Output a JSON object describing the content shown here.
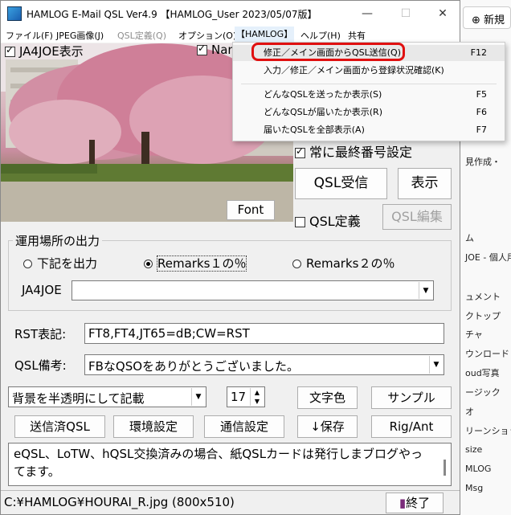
{
  "background_window": {
    "new_button": "新規",
    "items": [
      "ム",
      "JOE - 個人用",
      "ュメント",
      "クトップ",
      "チャ",
      "ウンロード",
      "oud写真",
      "ージック",
      "オ",
      "リーンショット",
      "size",
      "MLOG",
      "Msg",
      "見作成・"
    ]
  },
  "window": {
    "title": "HAMLOG E-Mail QSL Ver4.9 【HAMLOG_User 2023/05/07版】",
    "minimize": "—",
    "maximize": "☐",
    "close": "✕"
  },
  "menu": [
    "ファイル(F)",
    "JPEG画像(J)",
    "QSL定義(Q)",
    "オプション(O)",
    "【HAMLOG】",
    "ヘルプ(H)",
    "共有"
  ],
  "dropdown": [
    {
      "label": "修正／メイン画面からQSL送信(Q)",
      "key": "F12"
    },
    {
      "label": "入力／修正／メイン画面から登録状況確認(K)",
      "key": ""
    },
    {
      "label": "どんなQSLを送ったか表示(S)",
      "key": "F5"
    },
    {
      "label": "どんなQSLが届いたか表示(R)",
      "key": "F6"
    },
    {
      "label": "届いたQSLを全部表示(A)",
      "key": "F7"
    }
  ],
  "image_options": {
    "show_call": "JA4JOE表示",
    "show_name": "Nam",
    "font_button": "Font"
  },
  "right_controls": {
    "always_last": "常に最終番号設定",
    "qsl_receive": "QSL受信",
    "display": "表示",
    "qsl_define": "QSL定義",
    "qsl_edit": "QSL編集"
  },
  "location_group": {
    "title": "運用場所の出力",
    "options": [
      "下記を出力",
      "Remarks１の％",
      "Remarks２の％"
    ],
    "selected_index": 1,
    "call_label": "JA4JOE",
    "call_value": ""
  },
  "rst": {
    "label": "RST表記:",
    "value": "FT8,FT4,JT65=dB;CW=RST"
  },
  "qsl_note": {
    "label": "QSL備考:",
    "value": "FBなQSOをありがとうございました。"
  },
  "toolbar": {
    "bg_mode": "背景を半透明にして記載",
    "font_size": "17",
    "font_color": "文字色",
    "sample": "サンプル",
    "sent_qsl": "送信済QSL",
    "env_settings": "環境設定",
    "comm_settings": "通信設定",
    "save": "↓保存",
    "rig_ant": "Rig/Ant"
  },
  "message": "eQSL、LoTW、hQSL交換済みの場合、紙QSLカードは発行しまブログやってます。",
  "status": {
    "path": "C:¥HAMLOG¥HOURAI_R.jpg (800x510)",
    "exit": "終了"
  }
}
